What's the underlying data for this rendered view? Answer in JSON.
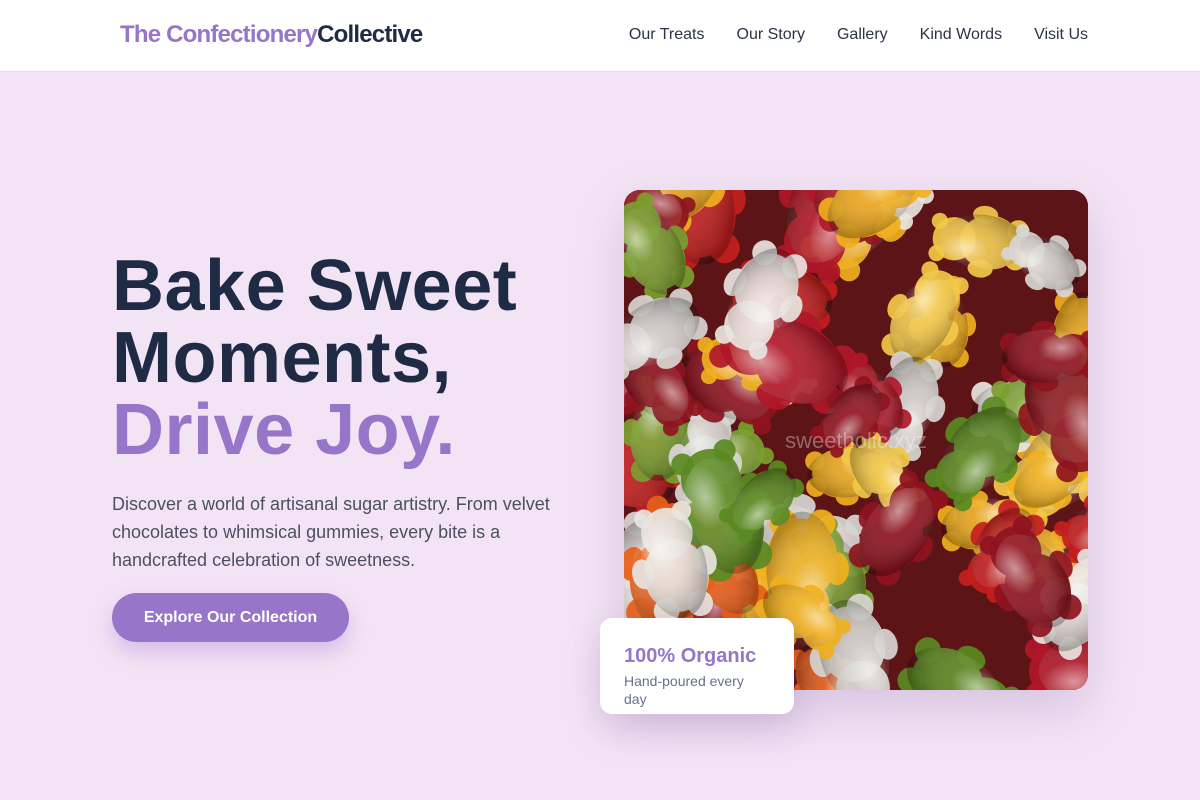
{
  "header": {
    "logo_accent": "The Confectionery",
    "logo_dark": "Collective",
    "nav": [
      "Our Treats",
      "Our Story",
      "Gallery",
      "Kind Words",
      "Visit Us"
    ]
  },
  "hero": {
    "title_line1": "Bake Sweet",
    "title_line2": "Moments,",
    "title_line3": "Drive Joy.",
    "description": "Discover a world of artisanal sugar artistry. From velvet chocolates to whimsical gummies, every bite is a handcrafted celebration of sweetness.",
    "cta_label": "Explore Our Collection"
  },
  "badge": {
    "title": "100% Organic",
    "subtitle": "Hand-poured every day"
  },
  "image": {
    "subject": "gummy-bears",
    "watermark": "sweetholic.xyz"
  },
  "colors": {
    "accent": "#9775c9",
    "background": "#f3e4f5",
    "text_dark": "#1f2a44"
  }
}
